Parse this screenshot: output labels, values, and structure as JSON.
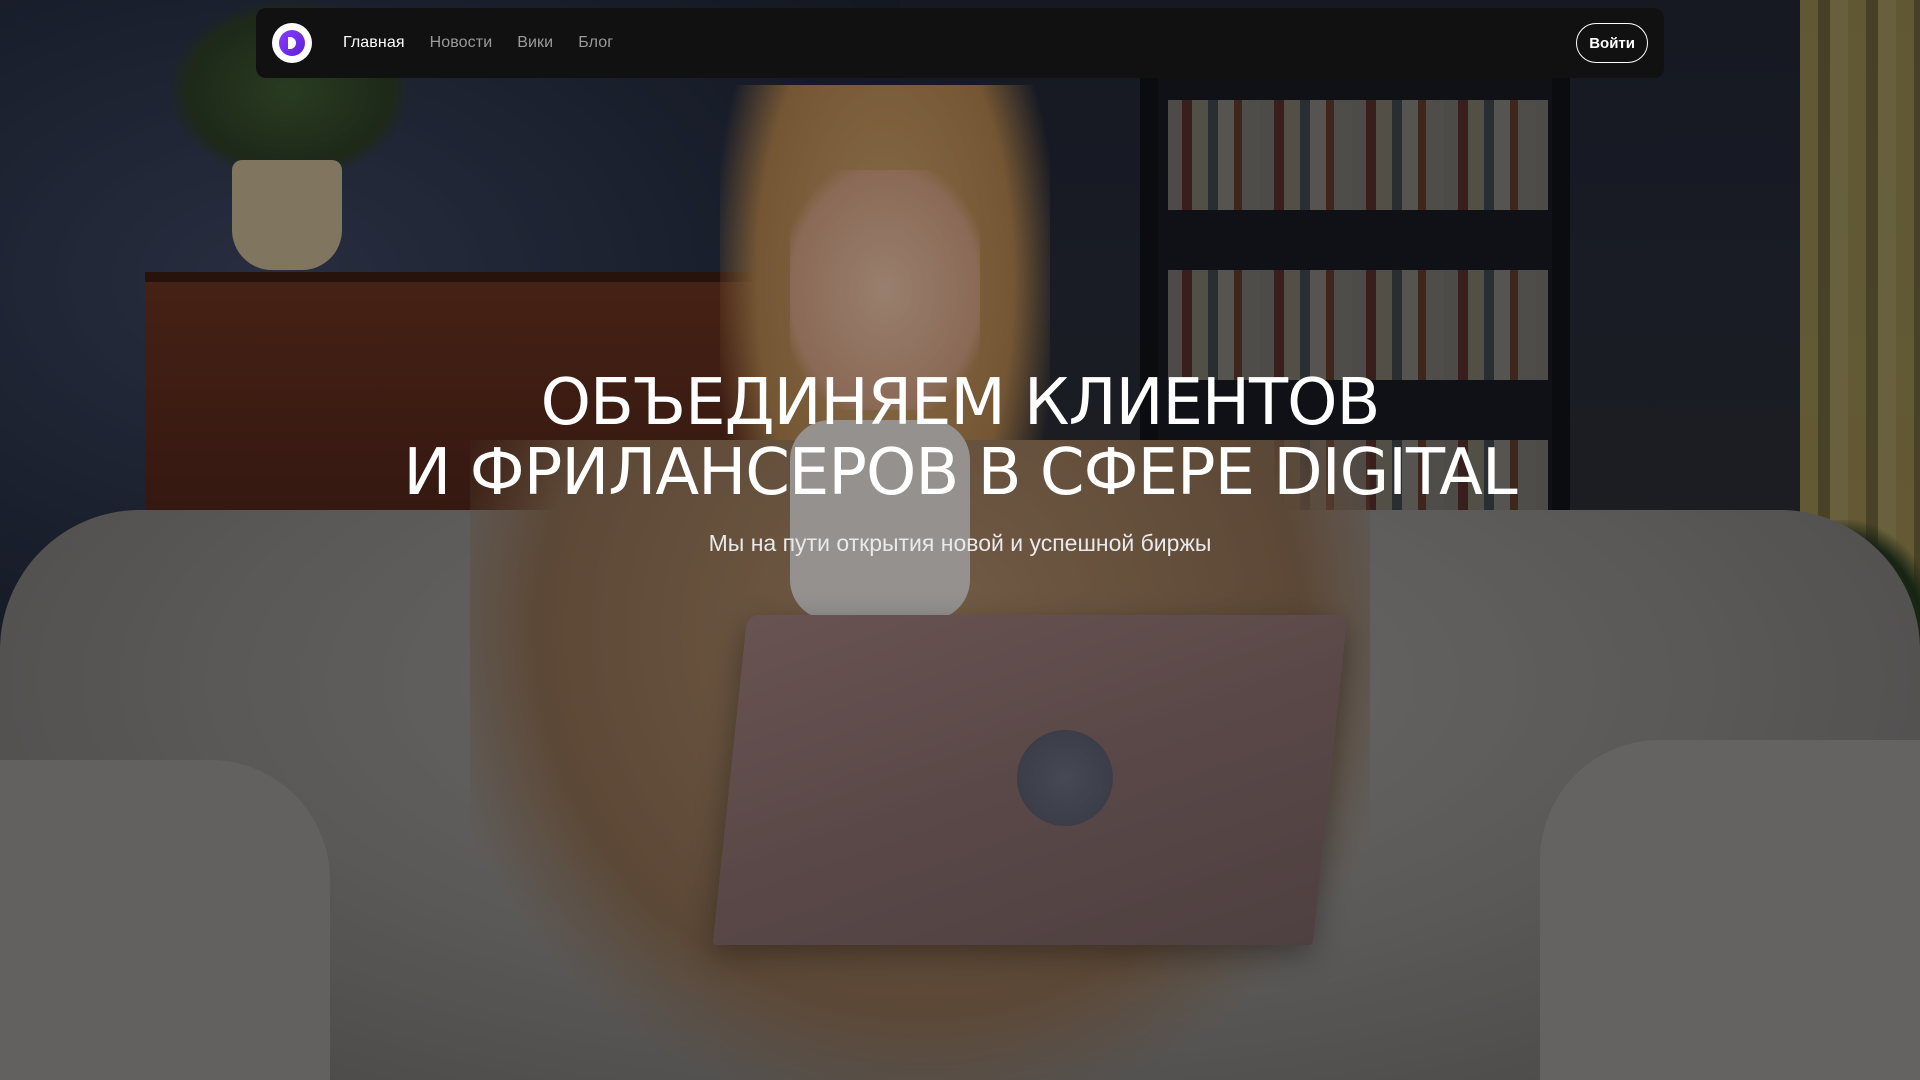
{
  "nav": {
    "logo_icon": "brand-logo-icon",
    "links": [
      {
        "label": "Главная",
        "active": true
      },
      {
        "label": "Новости",
        "active": false
      },
      {
        "label": "Вики",
        "active": false
      },
      {
        "label": "Блог",
        "active": false
      }
    ],
    "login_label": "Войти"
  },
  "hero": {
    "title_line1": "ОБЪЕДИНЯЕМ КЛИЕНТОВ",
    "title_line2": "И ФРИЛАНСЕРОВ В СФЕРЕ DIGITAL",
    "subtitle": "Мы на пути открытия новой и успешной биржы"
  },
  "colors": {
    "brand": "#7b2ff7",
    "navbar_bg": "#111111",
    "nav_text": "#9a9a9a",
    "nav_active": "#ffffff"
  }
}
